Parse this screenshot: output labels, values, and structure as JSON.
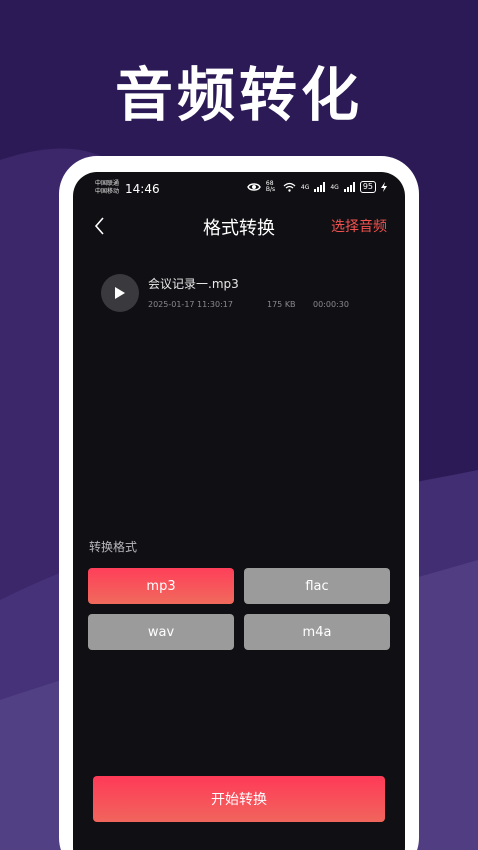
{
  "promo": {
    "headline": "音频转化"
  },
  "status_bar": {
    "carrier_1": "中国联通",
    "carrier_2": "中国移动",
    "time": "14:46",
    "net_speed": "68 B/s",
    "signal_1": "4G",
    "signal_2": "4G",
    "battery": "95"
  },
  "nav": {
    "title": "格式转换",
    "select_audio": "选择音频"
  },
  "file": {
    "name": "会议记录一.mp3",
    "date": "2025-01-17 11:30:17",
    "size": "175 KB",
    "duration": "00:00:30"
  },
  "formats": {
    "label": "转换格式",
    "options": [
      "mp3",
      "flac",
      "wav",
      "m4a"
    ],
    "selected": "mp3"
  },
  "actions": {
    "start": "开始转换"
  },
  "colors": {
    "background": "#2c1a56",
    "accent": "#f0524f",
    "button_inactive": "#9b9b9b",
    "screen": "#101014"
  },
  "icons": {
    "back": "chevron-left-icon",
    "play": "play-icon",
    "eye": "eye-icon",
    "wifi": "wifi-icon",
    "signal": "signal-icon",
    "charging": "bolt-icon"
  }
}
